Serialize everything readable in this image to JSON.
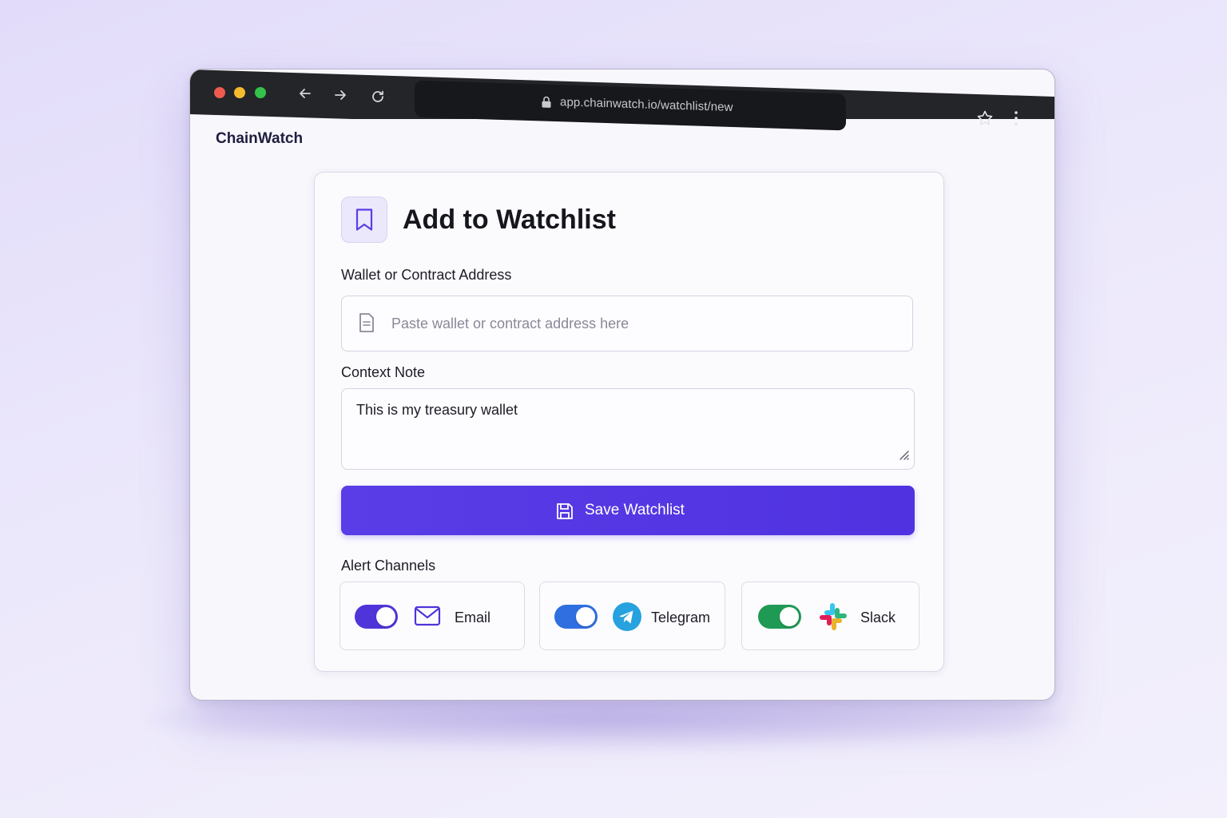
{
  "browser": {
    "url": "app.chainwatch.io/watchlist/new",
    "icons": [
      "back-arrow-icon",
      "forward-arrow-icon",
      "reload-icon",
      "lock-icon",
      "star-icon",
      "kebab-menu-icon"
    ]
  },
  "app": {
    "brand": "ChainWatch"
  },
  "form": {
    "title": "Add to Watchlist",
    "title_icon": "bookmark-icon",
    "address": {
      "label": "Wallet or Contract Address",
      "placeholder": "Paste wallet or contract address here",
      "value": ""
    },
    "note": {
      "label": "Context Note",
      "value": "This is my treasury wallet"
    },
    "save_button": {
      "label": "Save Watchlist",
      "icon": "floppy-disk-icon"
    },
    "channels": {
      "label": "Alert Channels",
      "items": [
        {
          "label": "Email",
          "enabled": true,
          "icon": "envelope-icon",
          "toggle_color": "#4f35d9"
        },
        {
          "label": "Telegram",
          "enabled": true,
          "icon": "telegram-icon",
          "toggle_color": "#2f6fe0"
        },
        {
          "label": "Slack",
          "enabled": true,
          "icon": "slack-icon",
          "toggle_color": "#1f9a55"
        }
      ]
    }
  },
  "colors": {
    "primary": "#5a3de6",
    "titlebar": "#232528",
    "background": "#e8e3fb"
  }
}
